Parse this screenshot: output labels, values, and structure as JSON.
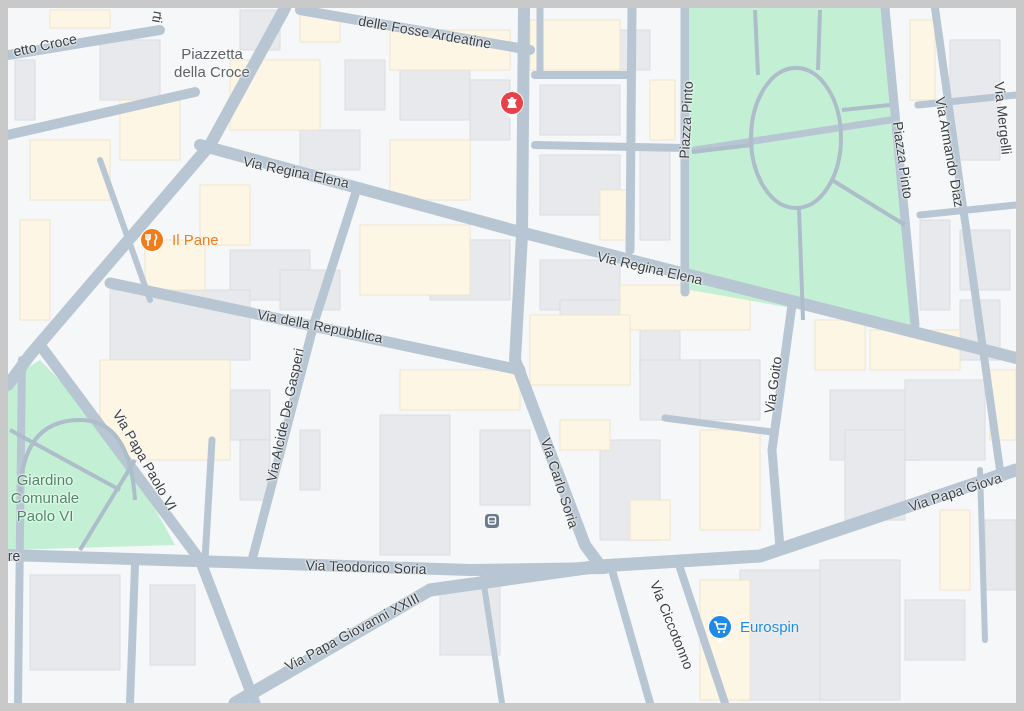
{
  "map": {
    "street_labels": [
      {
        "text": "etto Croce"
      },
      {
        "text": "rti"
      },
      {
        "text": "delle Fosse Ardeatine"
      },
      {
        "text": "Via Regina Elena"
      },
      {
        "text": "Via Regina Elena"
      },
      {
        "text": "Via della Repubblica"
      },
      {
        "text": "Via Alcide De Gasperi"
      },
      {
        "text": "Via Papa Paolo VI"
      },
      {
        "text": "Via Carlo Soria"
      },
      {
        "text": "Via Goito"
      },
      {
        "text": "Piazza Pinto"
      },
      {
        "text": "Piazza Pinto"
      },
      {
        "text": "Via Armando Diaz"
      },
      {
        "text": "Via Mergelli"
      },
      {
        "text": "re"
      },
      {
        "text": "Via Teodorico Soria"
      },
      {
        "text": "Via Papa Giovanni XXIII"
      },
      {
        "text": "Via Papa Giova"
      },
      {
        "text": "Via Ciccotonno"
      }
    ],
    "place_labels": [
      {
        "kind": "square",
        "text": "Piazzetta della Croce"
      },
      {
        "kind": "park",
        "text": "Giardino Comunale Paolo VI"
      }
    ],
    "pois": [
      {
        "kind": "landmark",
        "color": "#e8414a"
      },
      {
        "kind": "restaurant",
        "color": "#f07c1c",
        "label": "Il Pane"
      },
      {
        "kind": "transit",
        "color": "#6b7a8c"
      },
      {
        "kind": "shop",
        "color": "#1e8ae6",
        "label": "Eurospin"
      }
    ]
  }
}
